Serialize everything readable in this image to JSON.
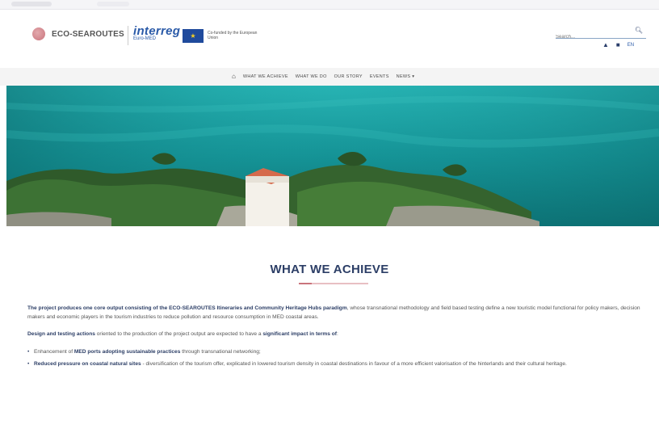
{
  "header": {
    "logo_text": "ECO-SEAROUTES",
    "interreg_name": "interreg",
    "interreg_program": "Euro-MED",
    "eu_text": "Co-funded by the European Union",
    "search_placeholder": "Search...",
    "language": "EN"
  },
  "nav": {
    "items": [
      {
        "label": "WHAT WE ACHIEVE"
      },
      {
        "label": "WHAT WE DO"
      },
      {
        "label": "OUR STORY"
      },
      {
        "label": "EVENTS"
      },
      {
        "label": "NEWS ▾"
      }
    ]
  },
  "main": {
    "title": "WHAT WE ACHIEVE",
    "intro_bold": "The project produces one core output consisting of the ECO-SEAROUTES Itineraries and Community Heritage Hubs paradigm",
    "intro_rest": ", whose transnational methodology and field based testing define a new touristic model functional for policy makers, decision makers and economic players in the tourism industries to reduce pollution and resource consumption in MED coastal areas.",
    "design_bold": "Design and testing actions",
    "design_mid": " oriented to the production of the project output are expected to have a ",
    "design_bold2": "significant impact in terms of",
    "design_end": ":",
    "bullets": [
      {
        "pre": "Enhancement of ",
        "bold": "MED ports adopting sustainable practices",
        "post": " through transnational networking;"
      },
      {
        "pre": "",
        "bold": "Reduced pressure on coastal natural sites",
        "post": " - diversification of the tourism offer, explicated in lowered tourism density in coastal destinations in favour of a more efficient valorisation of the hinterlands and their cultural heritage."
      }
    ]
  },
  "colors": {
    "brand_navy": "#2c3e66",
    "accent_pink": "#c9747c",
    "sea": "#138a8e"
  }
}
